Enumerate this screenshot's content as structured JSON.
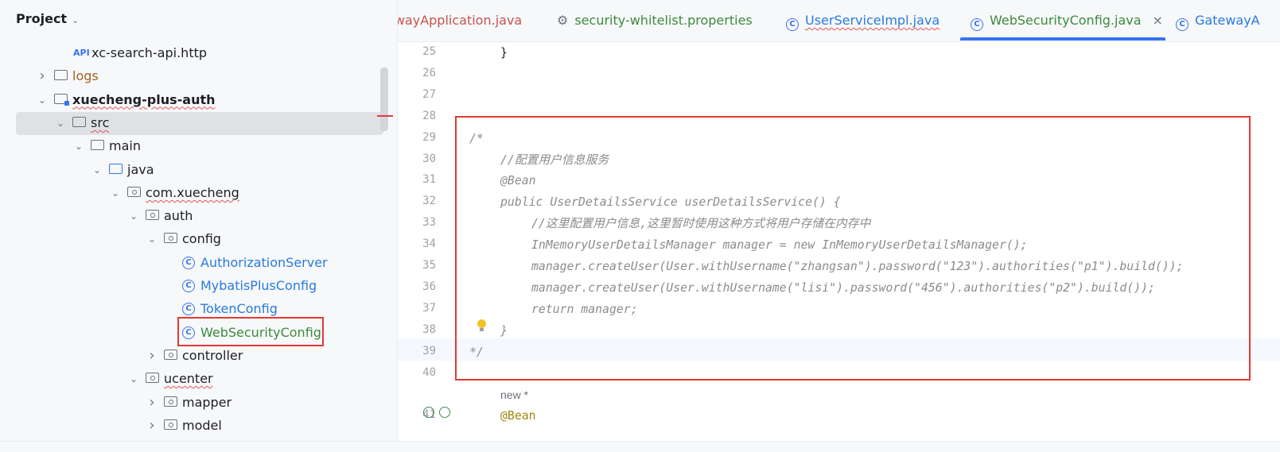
{
  "project": {
    "title": "Project",
    "tree": [
      {
        "label": "xc-search-api.http",
        "kind": "api",
        "icon_text": "API",
        "indent": 0,
        "arrow": "",
        "color": "#1e1f22",
        "squiggle": false
      },
      {
        "label": "logs",
        "kind": "folder",
        "indent": 1,
        "arrow": ">",
        "color": "#a0611f",
        "squiggle": false
      },
      {
        "label": "xuecheng-plus-auth",
        "kind": "module",
        "indent": 1,
        "arrow": "v",
        "color": "#1e1f22",
        "bold": true,
        "squiggle": true
      },
      {
        "label": "src",
        "kind": "folder",
        "indent": 2,
        "arrow": "v",
        "color": "#1e1f22",
        "squiggle": true,
        "selected": true
      },
      {
        "label": "main",
        "kind": "folder",
        "indent": 3,
        "arrow": "v",
        "color": "#1e1f22",
        "squiggle": false
      },
      {
        "label": "java",
        "kind": "folder-blue",
        "indent": 4,
        "arrow": "v",
        "color": "#1e1f22",
        "squiggle": false
      },
      {
        "label": "com.xuecheng",
        "kind": "package",
        "indent": 5,
        "arrow": "v",
        "color": "#1e1f22",
        "squiggle": true
      },
      {
        "label": "auth",
        "kind": "package",
        "indent": 6,
        "arrow": "v",
        "color": "#1e1f22",
        "squiggle": false
      },
      {
        "label": "config",
        "kind": "package",
        "indent": 7,
        "arrow": "v",
        "color": "#1e1f22",
        "squiggle": false
      },
      {
        "label": "AuthorizationServer",
        "kind": "class",
        "indent": 8,
        "arrow": "",
        "color": "#287bde",
        "squiggle": false
      },
      {
        "label": "MybatisPlusConfig",
        "kind": "class",
        "indent": 8,
        "arrow": "",
        "color": "#287bde",
        "squiggle": false
      },
      {
        "label": "TokenConfig",
        "kind": "class",
        "indent": 8,
        "arrow": "",
        "color": "#287bde",
        "squiggle": false
      },
      {
        "label": "WebSecurityConfig",
        "kind": "class",
        "indent": 8,
        "arrow": "",
        "color": "#3c8a3c",
        "squiggle": false
      },
      {
        "label": "controller",
        "kind": "package",
        "indent": 7,
        "arrow": ">",
        "color": "#1e1f22",
        "squiggle": false
      },
      {
        "label": "ucenter",
        "kind": "package",
        "indent": 6,
        "arrow": "v",
        "color": "#1e1f22",
        "squiggle": true
      },
      {
        "label": "mapper",
        "kind": "package",
        "indent": 7,
        "arrow": ">",
        "color": "#1e1f22",
        "squiggle": false
      },
      {
        "label": "model",
        "kind": "package",
        "indent": 7,
        "arrow": ">",
        "color": "#1e1f22",
        "squiggle": false
      }
    ]
  },
  "tabs": [
    {
      "label": "ewayApplication.java",
      "icon": "",
      "color": "#c75450",
      "squiggle": false,
      "active": false
    },
    {
      "label": "security-whitelist.properties",
      "icon": "gear-icon",
      "color": "#3c8a3c",
      "squiggle": false,
      "active": false
    },
    {
      "label": "UserServiceImpl.java",
      "icon": "class-icon",
      "color": "#287bde",
      "squiggle": true,
      "active": false
    },
    {
      "label": "WebSecurityConfig.java",
      "icon": "class-icon",
      "color": "#3c8a3c",
      "squiggle": false,
      "active": true,
      "close": "×"
    },
    {
      "label": "GatewayA",
      "icon": "class-icon",
      "color": "#287bde",
      "squiggle": false,
      "active": false
    }
  ],
  "editor": {
    "lines": [
      {
        "num": "25",
        "indent": 1,
        "parts": [
          {
            "t": "}",
            "s": ""
          }
        ]
      },
      {
        "num": "26",
        "indent": 0,
        "parts": []
      },
      {
        "num": "27",
        "indent": 0,
        "parts": []
      },
      {
        "num": "28",
        "indent": 0,
        "parts": []
      },
      {
        "num": "29",
        "indent": 0,
        "parts": [
          {
            "t": "/*",
            "s": "cmt"
          }
        ]
      },
      {
        "num": "30",
        "indent": 1,
        "parts": [
          {
            "t": "//配置用户信息服务",
            "s": "cmt"
          }
        ]
      },
      {
        "num": "31",
        "indent": 1,
        "parts": [
          {
            "t": "@Bean",
            "s": "cmt"
          }
        ]
      },
      {
        "num": "32",
        "indent": 1,
        "parts": [
          {
            "t": "public UserDetailsService userDetailsService() {",
            "s": "cmt"
          }
        ]
      },
      {
        "num": "33",
        "indent": 2,
        "parts": [
          {
            "t": "//这里配置用户信息,这里暂时使用这种方式将用户存储在内存中",
            "s": "cmt"
          }
        ]
      },
      {
        "num": "34",
        "indent": 2,
        "parts": [
          {
            "t": "InMemoryUserDetailsManager manager = new InMemoryUserDetailsManager();",
            "s": "cmt"
          }
        ]
      },
      {
        "num": "35",
        "indent": 2,
        "parts": [
          {
            "t": "manager.createUser(User.withUsername(\"zhangsan\").password(\"123\").authorities(\"p1\").build());",
            "s": "cmt"
          }
        ]
      },
      {
        "num": "36",
        "indent": 2,
        "parts": [
          {
            "t": "manager.createUser(User.withUsername(\"lisi\").password(\"456\").authorities(\"p2\").build());",
            "s": "cmt"
          }
        ]
      },
      {
        "num": "37",
        "indent": 2,
        "parts": [
          {
            "t": "return manager;",
            "s": "cmt"
          }
        ]
      },
      {
        "num": "38",
        "indent": 1,
        "parts": [
          {
            "t": "}",
            "s": "cmt"
          }
        ]
      },
      {
        "num": "39",
        "indent": 0,
        "parts": [
          {
            "t": "*/",
            "s": "cmt"
          }
        ]
      },
      {
        "num": "40",
        "indent": 0,
        "parts": []
      },
      {
        "num": "",
        "indent": 1,
        "parts": [
          {
            "t": "new *",
            "s": "hint"
          }
        ]
      },
      {
        "num": "41",
        "indent": 1,
        "parts": [
          {
            "t": "@Bean",
            "s": "annot"
          }
        ]
      }
    ]
  },
  "colors": {
    "accent": "#3574f0",
    "highlight_box": "#e53935"
  }
}
